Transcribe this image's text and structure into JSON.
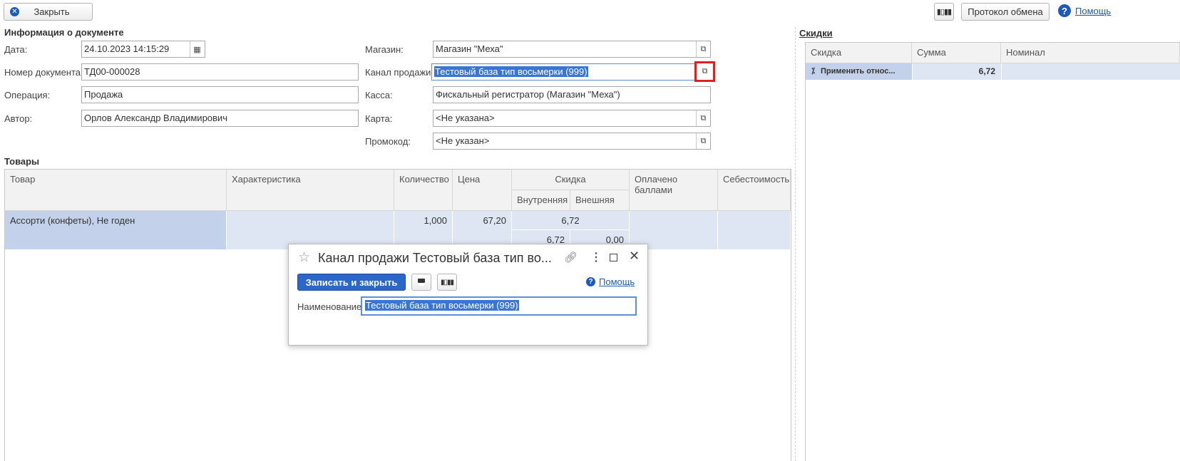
{
  "toolbar": {
    "close_label": "Закрыть",
    "exchange_label": "Протокол обмена",
    "help_label": "Помощь"
  },
  "doc_info": {
    "section_title": "Информация о документе",
    "date_label": "Дата:",
    "date_value": "24.10.2023 14:15:29",
    "number_label": "Номер документа:",
    "number_value": "ТД00-000028",
    "operation_label": "Операция:",
    "operation_value": "Продажа",
    "author_label": "Автор:",
    "author_value": "Орлов Александр Владимирович",
    "store_label": "Магазин:",
    "store_value": "Магазин \"Меха\"",
    "channel_label": "Канал продажи:",
    "channel_value": "Тестовый база тип восьмерки (999)",
    "cash_label": "Касса:",
    "cash_value": "Фискальный регистратор (Магазин \"Меха\")",
    "card_label": "Карта:",
    "card_value": "<Не указана>",
    "promo_label": "Промокод:",
    "promo_value": "<Не указан>"
  },
  "goods": {
    "section_title": "Товары",
    "columns": {
      "product": "Товар",
      "characteristic": "Характеристика",
      "quantity": "Количество",
      "price": "Цена",
      "discount": "Скидка",
      "internal": "Внутренняя",
      "external": "Внешняя",
      "paid_points": "Оплачено баллами",
      "cost": "Себестоимость"
    },
    "rows": [
      {
        "product": "Ассорти (конфеты), Не годен",
        "characteristic": "",
        "quantity": "1,000",
        "price": "67,20",
        "discount": "6,72",
        "internal": "6,72",
        "external": "0,00"
      }
    ]
  },
  "discounts": {
    "section_title": "Скидки",
    "columns": {
      "discount": "Скидка",
      "sum": "Сумма",
      "nominal": "Номинал"
    },
    "rows": [
      {
        "discount": "Применить относ...",
        "sum": "6,72",
        "nominal": ""
      }
    ]
  },
  "dialog": {
    "title": "Канал продажи Тестовый база тип во...",
    "save_close_label": "Записать и закрыть",
    "help_label": "Помощь",
    "name_label": "Наименование:",
    "name_value": "Тестовый база тип восьмерки (999)"
  },
  "colors": {
    "accent": "#1e5bb8",
    "highlight": "#e02020",
    "selected_row": "#dfe6f3"
  }
}
